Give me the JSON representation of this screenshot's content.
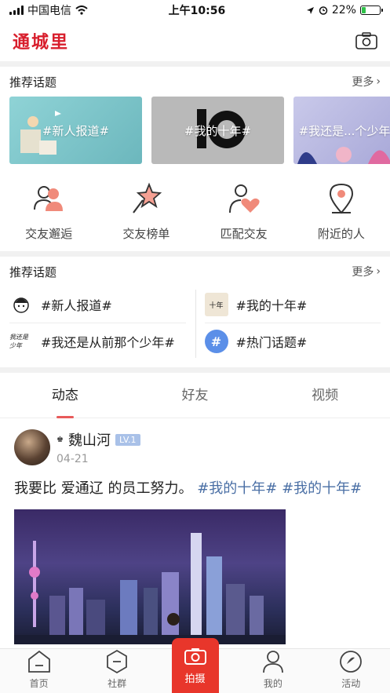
{
  "status_bar": {
    "carrier": "中国电信",
    "time": "上午10:56",
    "battery": "22%",
    "battery_level": 0.22
  },
  "app": {
    "logo": "通城里"
  },
  "hot_topics": {
    "title": "推荐话题",
    "more": "更多",
    "banners": [
      {
        "label": "#新人报道#"
      },
      {
        "label": "#我的十年#"
      },
      {
        "label": "#我还是...个少年"
      }
    ]
  },
  "quick_entries": [
    {
      "label": "交友邂逅",
      "icon": "people-icon"
    },
    {
      "label": "交友榜单",
      "icon": "star-wand-icon"
    },
    {
      "label": "匹配交友",
      "icon": "person-heart-icon"
    },
    {
      "label": "附近的人",
      "icon": "location-pin-icon"
    }
  ],
  "topic_list": {
    "title": "推荐话题",
    "more": "更多",
    "items": [
      {
        "label": "#新人报道#",
        "thumb_text": ""
      },
      {
        "label": "#我的十年#",
        "thumb_text": "十年"
      },
      {
        "label": "#我还是从前那个少年#",
        "thumb_text": "我还是少年"
      },
      {
        "label": "#热门话题#",
        "thumb_text": "#"
      }
    ]
  },
  "feed_tabs": [
    {
      "label": "动态",
      "active": true
    },
    {
      "label": "好友"
    },
    {
      "label": "视频"
    }
  ],
  "post": {
    "author": "魏山河",
    "level": "LV.1",
    "date": "04-21",
    "text": "我要比 爱通辽 的员工努力。",
    "tags": [
      "#我的十年#",
      "#我的十年#"
    ]
  },
  "bottom_nav": [
    {
      "label": "首页",
      "icon": "home-icon"
    },
    {
      "label": "社群",
      "icon": "community-icon"
    },
    {
      "label": "拍摄",
      "icon": "camera-icon"
    },
    {
      "label": "我的",
      "icon": "profile-icon"
    },
    {
      "label": "活动",
      "icon": "activity-icon"
    }
  ],
  "colors": {
    "brand": "#d81e2c",
    "accent": "#e8362b",
    "tag": "#4a6fa5",
    "level_badge": "#a9c1e8"
  }
}
